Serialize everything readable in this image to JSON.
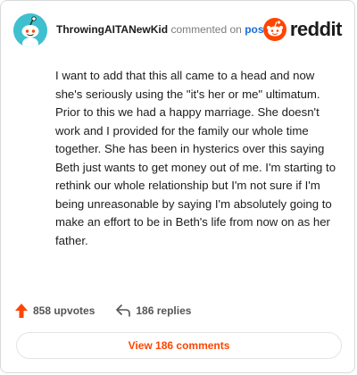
{
  "header": {
    "username": "ThrowingAITANewKid",
    "action": "commented on",
    "post_link": "post",
    "brand": "reddit"
  },
  "comment": {
    "text": "I want to add that this all came to a head and now she's seriously using the \"it's her or me\" ultimatum. Prior to this we had a happy marriage. She doesn't work and I provided for the family our whole time together. She has been in hysterics over this saying Beth just wants to get money out of me. I'm starting to rethink our whole relationship but I'm not sure if I'm being unreasonable by saying I'm absolutely going to make an effort to be in Beth's life from now on as her father."
  },
  "footer": {
    "upvotes": "858 upvotes",
    "replies": "186 replies",
    "view_comments": "View 186 comments"
  },
  "icons": {
    "avatar": "snoo-avatar-icon",
    "brand": "reddit-logo-icon",
    "upvote": "upvote-arrow-icon",
    "reply": "reply-arrow-icon"
  },
  "colors": {
    "accent": "#ff4500",
    "link": "#1a6dd6",
    "avatar_bg": "#3fc0cf"
  }
}
